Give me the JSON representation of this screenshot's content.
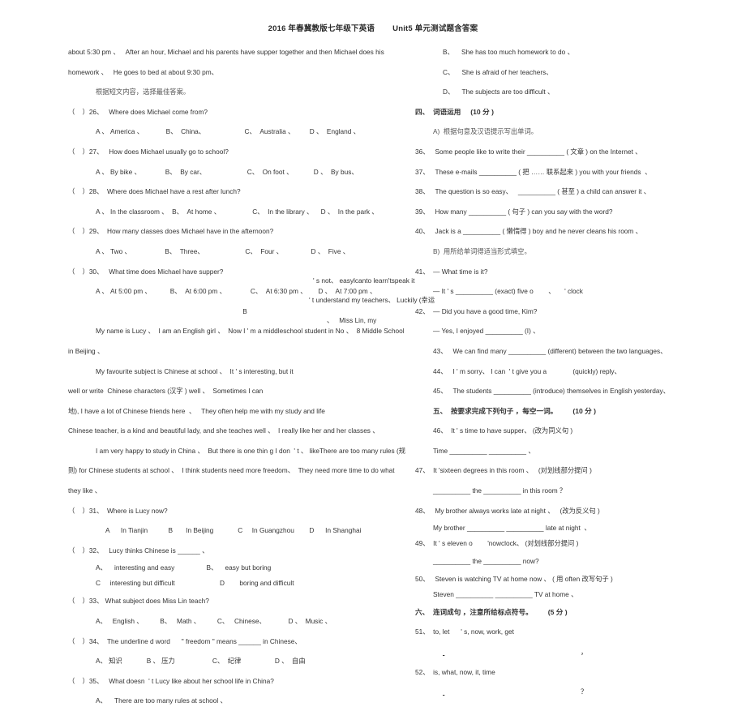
{
  "document": {
    "header_left": "2016 年春冀教版七年级下英语",
    "header_right": "Unit5  单元测试题含答案"
  },
  "left_column": {
    "passage_a_tail": [
      "about 5:30 pm 、   After an hour, Michael and his parents have supper together and then Michael does his",
      "homework 、   He goes to bed at about 9:30 pm、"
    ],
    "instruction_a": "根据短文内容，选择最佳答案。",
    "questions": [
      {
        "num": "（    ）26、   Where does Michael come from?",
        "options": "A 、 America 、            B、  China、                     C、  Australia 、        D 、  England 、"
      },
      {
        "num": "（    ）27、   How does Michael usually go to school?",
        "options": "A 、 By bike 、             B、  By car、                      C、  On foot 、           D 、  By bus、"
      },
      {
        "num": "（    ）28、  Where does Michael have a rest after lunch?",
        "options": "A 、 In the classroom 、  B、  At home 、                 C、  In the library 、    D 、  In the park 、"
      },
      {
        "num": "（    ）29、  How many classes does Michael have in the afternoon?",
        "options": "A 、 Two 、                  B、  Three、                      C、  Four 、               D 、  Five 、"
      },
      {
        "num": "（    ）30、   What time does Michael have supper?",
        "options": "A 、 At 5:00 pm 、          B、  At 6:00 pm 、             C、  At 6:30 pm 、      D 、  At 7:00 pm 、"
      }
    ],
    "passage_b_marker": "B",
    "passage_b": [
      "My name is Lucy 、  I am an English girl 、  Now I ' m a middleschool student in No 、  8 Middle School",
      "in Beijing 、",
      "My favourite subject is Chinese at school 、  It ' s interesting, but it",
      "well or write  Chinese characters (汉字 ) well 、  Sometimes I can",
      "地), I have a lot of Chinese friends here  、   They often help me with my study and life",
      "Chinese teacher, is a kind and beautiful lady, and she teaches well 、  I really like her and her classes 、",
      "I am very happy to study in China 、  But there is one thin g I don  ' t 、 likeThere are too many rules (规",
      "则) for Chinese students at school 、  I think students need more freedom、  They need more time to do what",
      "they like 、"
    ],
    "passage_b_overflow": [
      "' s not、 easylcanto learn'tspeak it",
      "' t understand my teachers、 Luckily (幸运",
      "、   Miss Lin, my"
    ],
    "questions_b": [
      {
        "num": "（    ）31、  Where is Lucy now?",
        "options": "A      In Tianjin           B       In Beijing             C     In Guangzhou        D      In Shanghai"
      },
      {
        "num": "（    ）32、   Lucy thinks Chinese is ______ 、",
        "opt_ab": "A、    interesting and easy                 B、    easy but boring",
        "opt_cd": "C     interesting but difficult                        D        boring and difficult"
      },
      {
        "num": "（    ）33、 What subject does Miss Lin teach?",
        "options": "A、   English 、         B、   Math 、         C、   Chinese、            D 、  Music 、"
      },
      {
        "num": "（    ）34、  The underline d word      \" freedom \" means ______ in Chinese、",
        "options": "A、 知识             B 、 压力                    C、  纪律                  D 、  自由"
      },
      {
        "num": "（    ）35、   What doesn  ' t Lucy like about her school life in China?",
        "options": "A、    There are too many rules at school 、"
      }
    ]
  },
  "right_column": {
    "q35_options": [
      "B、    She has too much homework to do 、",
      "C、    She is afraid of her teachers、",
      "D、    The subjects are too difficult 、"
    ],
    "section_four": "四、  词语运用     (10 分 )",
    "part_a_instruction": "A)  根据句意及汉语提示写出单词。",
    "items_36_40": [
      "36、   Some people like to write their __________ ( 文章 ) on the Internet 、",
      "37、   These e-mails __________ ( 把 …… 联系起来 ) you with your friends  、",
      "38、   The question is so easy、   __________ ( 甚至 ) a child can answer it 、",
      "39、   How many __________ ( 句子 ) can you say with the word?",
      "40、   Jack is a __________ ( 懒惰得 ) boy and he never cleans his room 、"
    ],
    "part_b_instruction": "B)  用所给单词得适当形式填空。",
    "items_41_45": [
      {
        "q": "41、  — What time is it?",
        "a": "— It ' s __________ (exact) five o        、     ' clock"
      },
      {
        "q": "42、  — Did you have a good time, Kim?",
        "a": "— Yes, I enjoyed __________ (I) 、"
      },
      {
        "q": "43、   We can find many __________ (different) between the two languages、",
        "a": ""
      },
      {
        "q": "44、   I ' m sorry、 I can  ' t give you a              (quickly) reply、",
        "a": ""
      },
      {
        "q": "45、   The students __________ (introduce) themselves in English yesterday、",
        "a": ""
      }
    ],
    "section_five": "五、  按要求完成下列句子 ，每空一词。        (10 分 )",
    "items_46_50": [
      {
        "q": "46、  It ' s time to have supper、 (改为同义句 )",
        "a": "Time __________ __________ 、"
      },
      {
        "q": "47、  It 'sixteen degrees in this room 、   (对划线部分提问 )",
        "a": "__________ the __________ in this room ？"
      },
      {
        "q": "48、   My brother always works late at night 、   (改为反义句 )",
        "a": "My brother __________ __________ late at night  、"
      },
      {
        "q": "49、  It ' s eleven o        'nowclock、 (对划线部分提问 )",
        "a": "__________ the __________ now?"
      },
      {
        "q": "50、   Steven is watching TV at home now 、 ( 用 often 改写句子 )",
        "a": "Steven __________ __________ TV at home 、"
      }
    ],
    "section_six": "六、  连词成句 ，注意所给标点符号。        (5 分 )",
    "items_51_52": [
      {
        "q": "51、  to, let      ' s, now, work, get",
        "a": "，"
      },
      {
        "q": "52、  is, what, now, it, time",
        "a": "？"
      }
    ]
  }
}
